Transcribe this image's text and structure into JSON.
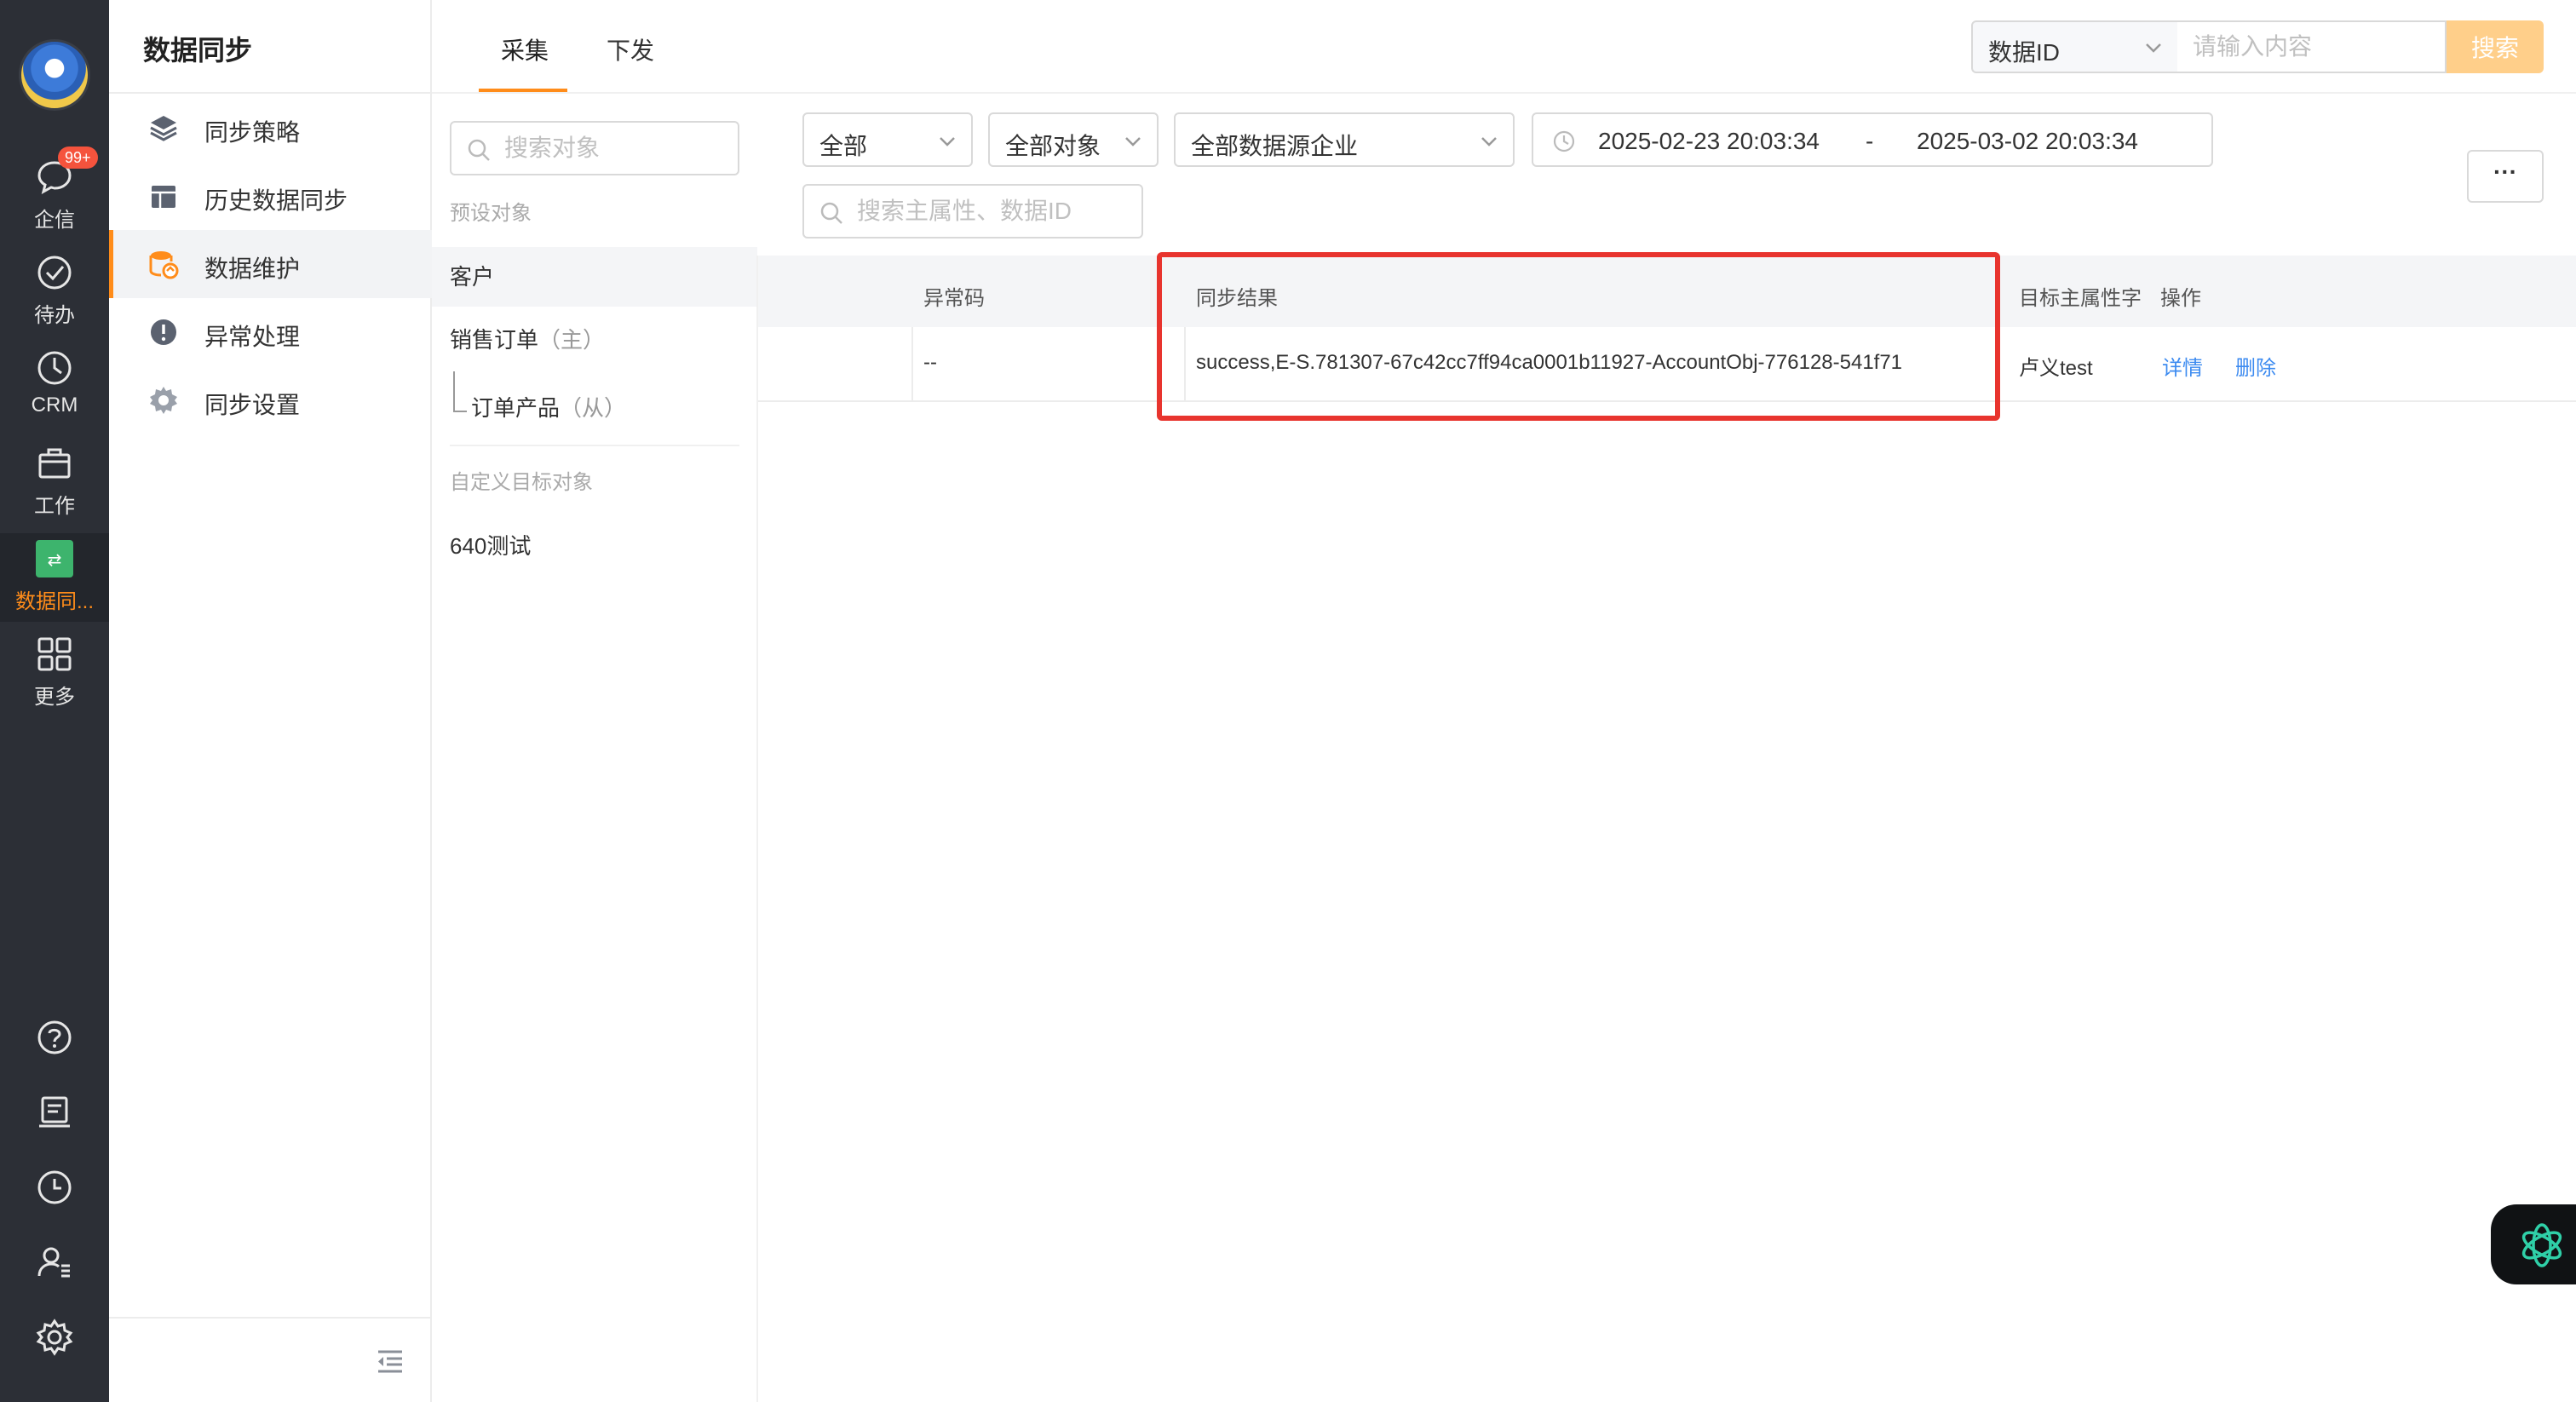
{
  "rail": {
    "items": [
      {
        "label": "企信",
        "icon": "chat-icon",
        "badge": "99+"
      },
      {
        "label": "待办",
        "icon": "check-circle-icon"
      },
      {
        "label": "CRM",
        "icon": "clock-icon"
      },
      {
        "label": "工作",
        "icon": "briefcase-icon"
      },
      {
        "label": "数据同...",
        "icon": "data-sync-app-icon",
        "active": true
      },
      {
        "label": "更多",
        "icon": "grid-icon"
      }
    ],
    "bottom_icons": [
      "help-icon",
      "notes-icon",
      "history-icon",
      "user-settings-icon",
      "settings-icon"
    ]
  },
  "menu": {
    "title": "数据同步",
    "items": [
      {
        "label": "同步策略",
        "icon": "layers-icon"
      },
      {
        "label": "历史数据同步",
        "icon": "history-table-icon"
      },
      {
        "label": "数据维护",
        "icon": "database-sync-icon",
        "active": true
      },
      {
        "label": "异常处理",
        "icon": "alert-icon"
      },
      {
        "label": "同步设置",
        "icon": "gear-icon"
      }
    ]
  },
  "tabs": [
    {
      "label": "采集",
      "active": true
    },
    {
      "label": "下发"
    }
  ],
  "top_search": {
    "field_select": "数据ID",
    "placeholder": "请输入内容",
    "button": "搜索"
  },
  "objects": {
    "search_placeholder": "搜索对象",
    "preset_label": "预设对象",
    "preset_items": [
      {
        "label": "客户",
        "active": true
      },
      {
        "label": "销售订单",
        "tag": "（主）"
      },
      {
        "label": "订单产品",
        "tag": "（从）"
      }
    ],
    "custom_label": "自定义目标对象",
    "custom_items": [
      {
        "label": "640测试"
      }
    ]
  },
  "filters": {
    "status": "全部",
    "object": "全部对象",
    "source": "全部数据源企业",
    "date_start": "2025-02-23 20:03:34",
    "date_sep": "-",
    "date_end": "2025-03-02 20:03:34",
    "attr_search_placeholder": "搜索主属性、数据ID",
    "more": "···"
  },
  "table": {
    "columns": [
      "异常码",
      "同步结果",
      "目标主属性字段",
      "操作"
    ],
    "rows": [
      {
        "error_code": "--",
        "result": "success,E-S.781307-67c42cc7ff94ca0001b11927-AccountObj-776128-541f71",
        "target": "卢义test",
        "actions": [
          "详情",
          "删除"
        ]
      }
    ]
  },
  "colors": {
    "accent": "#ff8c1a",
    "rail_bg": "#2c2f36",
    "link": "#3d8bf0",
    "highlight": "#e8342e"
  }
}
